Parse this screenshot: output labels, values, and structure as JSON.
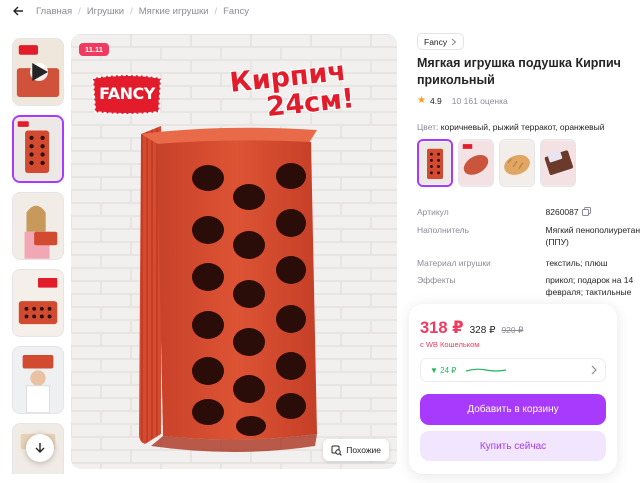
{
  "breadcrumb": {
    "items": [
      "Главная",
      "Игрушки",
      "Мягкие игрушки",
      "Fancy"
    ]
  },
  "gallery": {
    "promo_badge": "11.11",
    "logo_text": "FANCY",
    "headline_line1": "Кирпич",
    "headline_line2": "24см!",
    "similar_label": "Похожие"
  },
  "product": {
    "brand": "Fancy",
    "title": "Мягкая игрушка подушка Кирпич прикольный",
    "rating": "4.9",
    "reviews": "10 161 оценка",
    "color_label": "Цвет:",
    "color_value": "коричневый, рыжий терракот, оранжевый"
  },
  "specs": [
    {
      "key": "Артикул",
      "value": "8260087"
    },
    {
      "key": "Наполнитель",
      "value": "Мягкий пенополиуретан"
    },
    {
      "key": "",
      "value": "(ППУ)"
    },
    {
      "key": "Материал игрушки",
      "value": "текстиль; плюш"
    },
    {
      "key": "Эффекты",
      "value": "прикол; подарок на 14"
    },
    {
      "key": "",
      "value": "февраля; тактильные"
    }
  ],
  "price": {
    "current": "318 ₽",
    "old": "328 ₽",
    "crossed": "920 ₽",
    "wallet_note": "с WB Кошельком",
    "history_value": "▼ 24 ₽"
  },
  "actions": {
    "add_to_cart": "Добавить в корзину",
    "buy_now": "Купить сейчас"
  },
  "colors": {
    "accent": "#a73afd",
    "price": "#f03a5f",
    "brick": "#d8472f"
  }
}
